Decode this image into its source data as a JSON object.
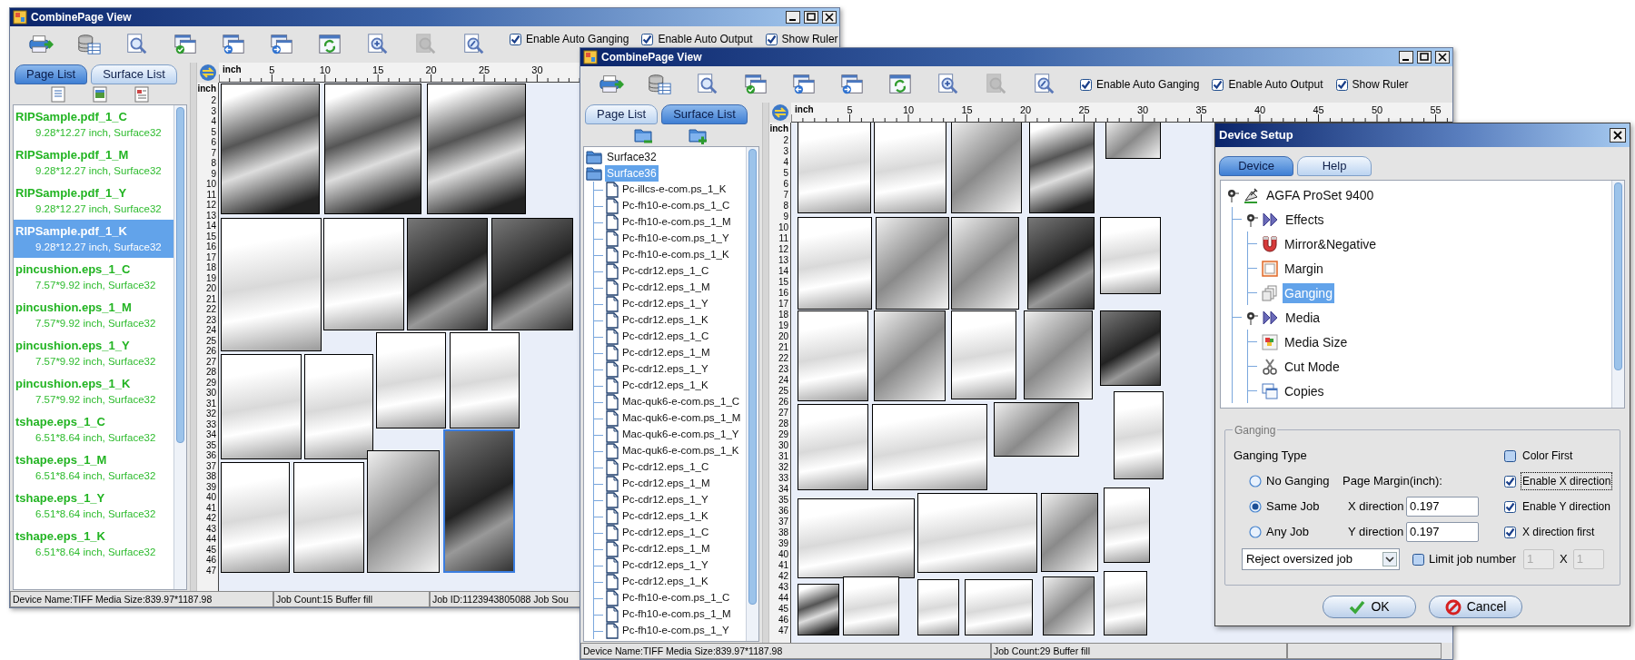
{
  "main_window": {
    "title": "CombinePage View",
    "toolbar": [
      {
        "kind": "print",
        "disabled": false
      },
      {
        "kind": "database",
        "disabled": false
      },
      {
        "kind": "preview",
        "disabled": false
      },
      {
        "kind": "window_check",
        "disabled": false
      },
      {
        "kind": "window_back",
        "disabled": false
      },
      {
        "kind": "window_forward",
        "disabled": false
      },
      {
        "kind": "refresh",
        "disabled": false
      },
      {
        "kind": "zoom_in",
        "disabled": false
      },
      {
        "kind": "zoom_out",
        "disabled": true
      },
      {
        "kind": "zoom_custom",
        "disabled": false
      }
    ],
    "checkboxes": [
      {
        "label": "Enable Auto Ganging",
        "checked": true
      },
      {
        "label": "Enable Auto Output",
        "checked": true
      },
      {
        "label": "Show Ruler",
        "checked": true
      }
    ],
    "tabs": [
      {
        "label": "Page List",
        "selected": true
      },
      {
        "label": "Surface List",
        "selected": false
      }
    ],
    "page_list": [
      {
        "name": "RIPSample.pdf_1_C",
        "detail": "9.28*12.27 inch, Surface32",
        "selected": false
      },
      {
        "name": "RIPSample.pdf_1_M",
        "detail": "9.28*12.27 inch, Surface32",
        "selected": false
      },
      {
        "name": "RIPSample.pdf_1_Y",
        "detail": "9.28*12.27 inch, Surface32",
        "selected": false
      },
      {
        "name": "RIPSample.pdf_1_K",
        "detail": "9.28*12.27 inch, Surface32",
        "selected": true
      },
      {
        "name": "pincushion.eps_1_C",
        "detail": "7.57*9.92 inch, Surface32",
        "selected": false
      },
      {
        "name": "pincushion.eps_1_M",
        "detail": "7.57*9.92 inch, Surface32",
        "selected": false
      },
      {
        "name": "pincushion.eps_1_Y",
        "detail": "7.57*9.92 inch, Surface32",
        "selected": false
      },
      {
        "name": "pincushion.eps_1_K",
        "detail": "7.57*9.92 inch, Surface32",
        "selected": false
      },
      {
        "name": "tshape.eps_1_C",
        "detail": "6.51*8.64 inch, Surface32",
        "selected": false
      },
      {
        "name": "tshape.eps_1_M",
        "detail": "6.51*8.64 inch, Surface32",
        "selected": false
      },
      {
        "name": "tshape.eps_1_Y",
        "detail": "6.51*8.64 inch, Surface32",
        "selected": false
      },
      {
        "name": "tshape.eps_1_K",
        "detail": "6.51*8.64 inch, Surface32",
        "selected": false
      }
    ],
    "ruler": {
      "top_unit": "inch",
      "side_unit": "inch",
      "x_labels": [
        "5",
        "10",
        "15",
        "20",
        "25",
        "30"
      ],
      "y_labels": [
        "2",
        "3",
        "4",
        "5",
        "6",
        "7",
        "8",
        "9",
        "10",
        "11",
        "12",
        "13",
        "14",
        "15",
        "16",
        "17",
        "18",
        "19",
        "20",
        "21",
        "22",
        "23",
        "24",
        "25",
        "26",
        "27",
        "28",
        "29",
        "30",
        "31",
        "32",
        "33",
        "34",
        "35",
        "36",
        "37",
        "38",
        "39",
        "40",
        "41",
        "42",
        "43",
        "44",
        "45",
        "46",
        "47"
      ]
    },
    "canvas_pages": [
      {
        "selected": false
      },
      {
        "selected": false
      },
      {
        "selected": false
      },
      {
        "selected": false
      },
      {
        "selected": false
      },
      {
        "selected": false
      },
      {
        "selected": false
      },
      {
        "selected": false
      },
      {
        "selected": false
      },
      {
        "selected": false
      },
      {
        "selected": false
      },
      {
        "selected": false
      },
      {
        "selected": false
      },
      {
        "selected": false
      },
      {
        "selected": true
      }
    ],
    "status_bar": [
      "Device Name:TIFF  Media Size:839.97*1187.98",
      "Job Count:15  Buffer fill",
      "Job ID:1123943805088  Job Sou"
    ]
  },
  "surface_window": {
    "title": "CombinePage View",
    "toolbar": [
      {
        "kind": "print",
        "disabled": false
      },
      {
        "kind": "database",
        "disabled": false
      },
      {
        "kind": "preview",
        "disabled": false
      },
      {
        "kind": "window_check",
        "disabled": false
      },
      {
        "kind": "window_back",
        "disabled": false
      },
      {
        "kind": "window_forward",
        "disabled": false
      },
      {
        "kind": "refresh",
        "disabled": false
      },
      {
        "kind": "zoom_in",
        "disabled": false
      },
      {
        "kind": "zoom_out",
        "disabled": true
      },
      {
        "kind": "zoom_custom",
        "disabled": false
      }
    ],
    "checkboxes": [
      {
        "label": "Enable Auto Ganging",
        "checked": true
      },
      {
        "label": "Enable Auto Output",
        "checked": true
      },
      {
        "label": "Show Ruler",
        "checked": true
      }
    ],
    "tabs": [
      {
        "label": "Page List",
        "selected": false
      },
      {
        "label": "Surface List",
        "selected": true
      }
    ],
    "surface_tree": [
      {
        "label": "Surface32",
        "selected": false
      },
      {
        "label": "Surface36",
        "selected": true,
        "children": [
          {
            "label": "Pc-illcs-e-com.ps_1_K",
            "selected": false
          },
          {
            "label": "Pc-fh10-e-com.ps_1_C",
            "selected": false
          },
          {
            "label": "Pc-fh10-e-com.ps_1_M",
            "selected": false
          },
          {
            "label": "Pc-fh10-e-com.ps_1_Y",
            "selected": false
          },
          {
            "label": "Pc-fh10-e-com.ps_1_K",
            "selected": false
          },
          {
            "label": "Pc-cdr12.eps_1_C",
            "selected": false
          },
          {
            "label": "Pc-cdr12.eps_1_M",
            "selected": false
          },
          {
            "label": "Pc-cdr12.eps_1_Y",
            "selected": false
          },
          {
            "label": "Pc-cdr12.eps_1_K",
            "selected": false
          },
          {
            "label": "Pc-cdr12.eps_1_C",
            "selected": false
          },
          {
            "label": "Pc-cdr12.eps_1_M",
            "selected": false
          },
          {
            "label": "Pc-cdr12.eps_1_Y",
            "selected": false
          },
          {
            "label": "Pc-cdr12.eps_1_K",
            "selected": false
          },
          {
            "label": "Mac-quk6-e-com.ps_1_C",
            "selected": false
          },
          {
            "label": "Mac-quk6-e-com.ps_1_M",
            "selected": false
          },
          {
            "label": "Mac-quk6-e-com.ps_1_Y",
            "selected": false
          },
          {
            "label": "Mac-quk6-e-com.ps_1_K",
            "selected": false
          },
          {
            "label": "Pc-cdr12.eps_1_C",
            "selected": false
          },
          {
            "label": "Pc-cdr12.eps_1_M",
            "selected": false
          },
          {
            "label": "Pc-cdr12.eps_1_Y",
            "selected": false
          },
          {
            "label": "Pc-cdr12.eps_1_K",
            "selected": false
          },
          {
            "label": "Pc-cdr12.eps_1_C",
            "selected": false
          },
          {
            "label": "Pc-cdr12.eps_1_M",
            "selected": false
          },
          {
            "label": "Pc-cdr12.eps_1_Y",
            "selected": false
          },
          {
            "label": "Pc-cdr12.eps_1_K",
            "selected": false
          },
          {
            "label": "Pc-fh10-e-com.ps_1_C",
            "selected": false
          },
          {
            "label": "Pc-fh10-e-com.ps_1_M",
            "selected": false
          },
          {
            "label": "Pc-fh10-e-com.ps_1_Y",
            "selected": false
          }
        ]
      }
    ],
    "ruler": {
      "top_unit": "inch",
      "side_unit": "inch",
      "x_labels": [
        "5",
        "10",
        "15",
        "20",
        "25",
        "30",
        "35",
        "40",
        "45",
        "50",
        "55"
      ],
      "y_labels": [
        "2",
        "3",
        "4",
        "5",
        "6",
        "7",
        "8",
        "9",
        "10",
        "11",
        "12",
        "13",
        "14",
        "15",
        "16",
        "17",
        "18",
        "19",
        "20",
        "21",
        "22",
        "23",
        "24",
        "25",
        "26",
        "27",
        "28",
        "29",
        "30",
        "31",
        "32",
        "33",
        "34",
        "35",
        "36",
        "37",
        "38",
        "39",
        "40",
        "41",
        "42",
        "43",
        "44",
        "45",
        "46",
        "47"
      ]
    },
    "status_bar": [
      "Device Name:TIFF  Media Size:839.97*1187.98",
      "Job Count:29  Buffer fill"
    ]
  },
  "device_setup": {
    "title": "Device Setup",
    "tabs": [
      {
        "label": "Device",
        "selected": true
      },
      {
        "label": "Help",
        "selected": false
      }
    ],
    "tree": [
      {
        "label": "AGFA ProSet 9400",
        "kind": "device",
        "selected": false,
        "expanded": true,
        "children": [
          {
            "label": "Effects",
            "kind": "group",
            "selected": false,
            "expanded": true,
            "children": [
              {
                "label": "Mirror&Negative",
                "kind": "mirror",
                "selected": false
              },
              {
                "label": "Margin",
                "kind": "margin",
                "selected": false
              },
              {
                "label": "Ganging",
                "kind": "ganging",
                "selected": true
              }
            ]
          },
          {
            "label": "Media",
            "kind": "group",
            "selected": false,
            "expanded": true,
            "children": [
              {
                "label": "Media Size",
                "kind": "media_size",
                "selected": false
              },
              {
                "label": "Cut Mode",
                "kind": "cut_mode",
                "selected": false
              },
              {
                "label": "Copies",
                "kind": "copies",
                "selected": false
              }
            ]
          }
        ]
      }
    ],
    "ganging": {
      "legend": "Ganging",
      "type_label": "Ganging Type",
      "types": [
        {
          "label": "No Ganging",
          "selected": false
        },
        {
          "label": "Same Job",
          "selected": true
        },
        {
          "label": "Any Job",
          "selected": false
        }
      ],
      "margin_label": "Page Margin(inch):",
      "margins": [
        {
          "label": "X direction",
          "value": "0.197"
        },
        {
          "label": "Y direction",
          "value": "0.197"
        }
      ],
      "options": [
        {
          "label": "Color First",
          "checked": false,
          "focused": false
        },
        {
          "label": "Enable X direction",
          "checked": true,
          "focused": true
        },
        {
          "label": "Enable Y direction",
          "checked": true,
          "focused": false
        },
        {
          "label": "X direction first",
          "checked": true,
          "focused": false
        }
      ],
      "oversize": {
        "value": "Reject oversized job"
      },
      "limit": {
        "label": "Limit job number",
        "checked": false,
        "separator": "X",
        "fields": [
          {
            "value": "1",
            "disabled": true
          },
          {
            "value": "1",
            "disabled": true
          }
        ]
      }
    },
    "buttons": [
      {
        "label": "OK",
        "kind": "ok"
      },
      {
        "label": "Cancel",
        "kind": "cancel"
      }
    ]
  }
}
